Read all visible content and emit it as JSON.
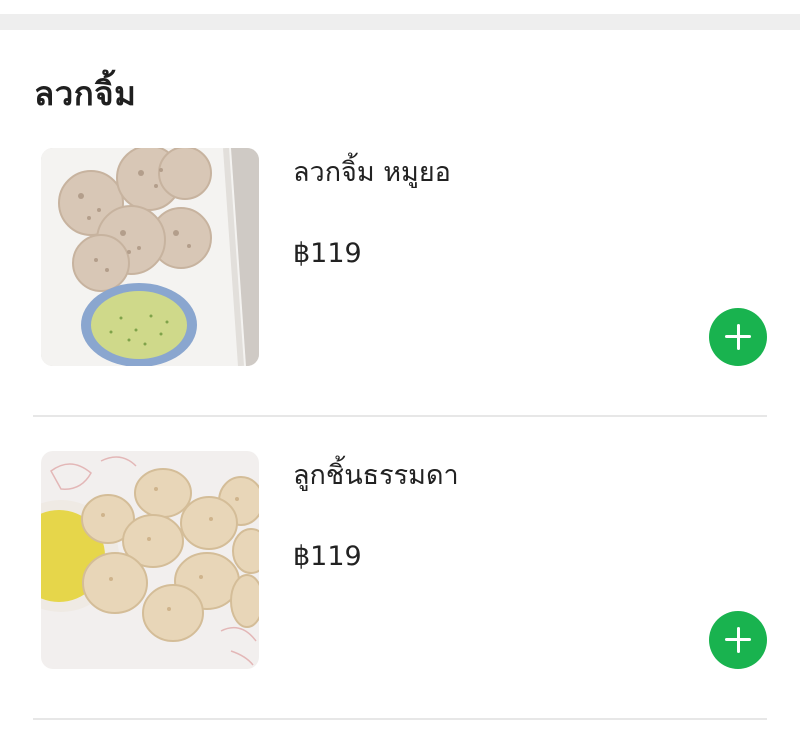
{
  "section": {
    "title": "ลวกจิ้ม"
  },
  "items": [
    {
      "name": "ลวกจิ้ม หมูยอ",
      "price": "฿119",
      "image": "sliced-pork-sausage-with-dipping-sauce",
      "add_icon": "plus-icon"
    },
    {
      "name": "ลูกชิ้นธรรมดา",
      "price": "฿119",
      "image": "meatballs-with-dipping-sauce",
      "add_icon": "plus-icon"
    }
  ],
  "colors": {
    "accent": "#19b34f",
    "text": "#222222",
    "divider": "#e7e7e7",
    "top_strip": "#eeeeee"
  }
}
